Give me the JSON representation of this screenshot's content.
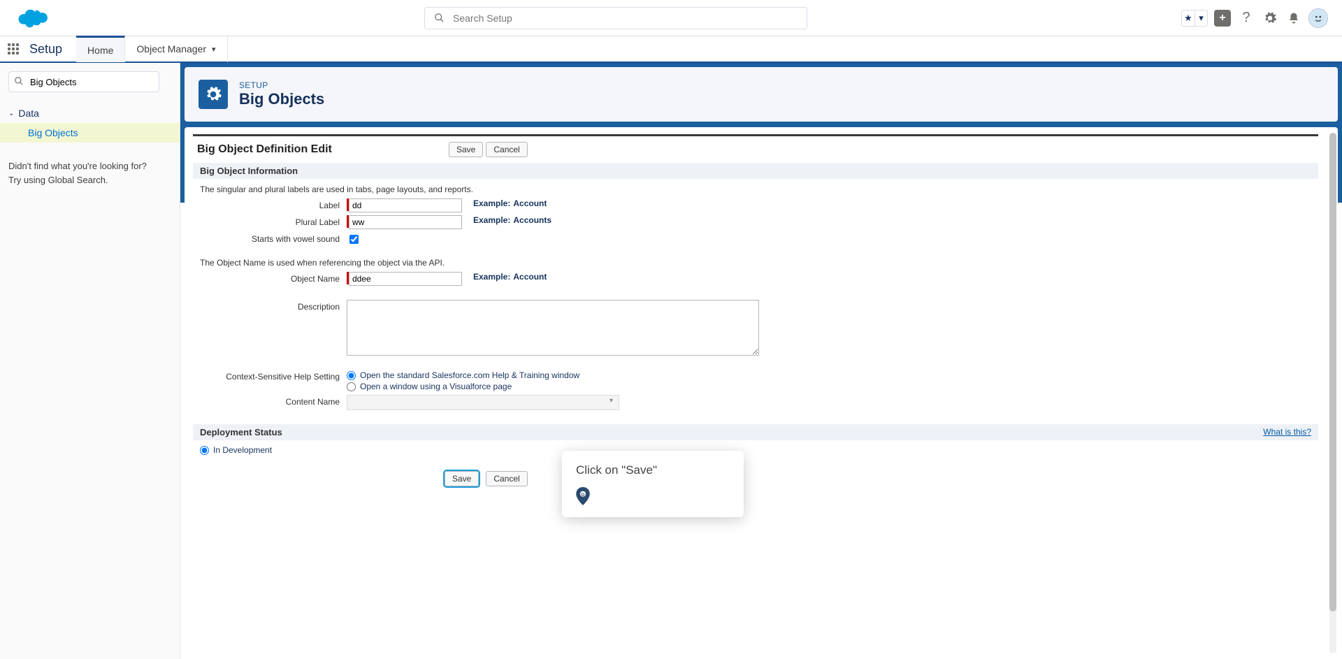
{
  "header": {
    "search_placeholder": "Search Setup"
  },
  "nav": {
    "app_title": "Setup",
    "tab_home": "Home",
    "tab_object_manager": "Object Manager"
  },
  "sidebar": {
    "quick_find_value": "Big Objects",
    "section_data": "Data",
    "item_big_objects": "Big Objects",
    "footer_line1": "Didn't find what you're looking for?",
    "footer_line2": "Try using Global Search."
  },
  "page_header": {
    "breadcrumb": "SETUP",
    "title": "Big Objects"
  },
  "panel": {
    "title": "Big Object Definition Edit",
    "save": "Save",
    "cancel": "Cancel"
  },
  "section_info": {
    "title": "Big Object Information",
    "intro": "The singular and plural labels are used in tabs, page layouts, and reports.",
    "label_label": "Label",
    "label_value": "dd",
    "example_label": "Example:",
    "example_account": "Account",
    "plural_label": "Plural Label",
    "plural_value": "ww",
    "example_accounts": "Accounts",
    "vowel_label": "Starts with vowel sound",
    "api_intro": "The Object Name is used when referencing the object via the API.",
    "object_name_label": "Object Name",
    "object_name_value": "ddee",
    "description_label": "Description",
    "help_setting_label": "Context-Sensitive Help Setting",
    "help_opt1": "Open the standard Salesforce.com Help & Training window",
    "help_opt2": "Open a window using a Visualforce page",
    "content_name_label": "Content Name"
  },
  "section_deploy": {
    "title": "Deployment Status",
    "what_is_this": "What is this?",
    "in_development": "In Development"
  },
  "tooltip": {
    "text": "Click on \"Save\""
  }
}
